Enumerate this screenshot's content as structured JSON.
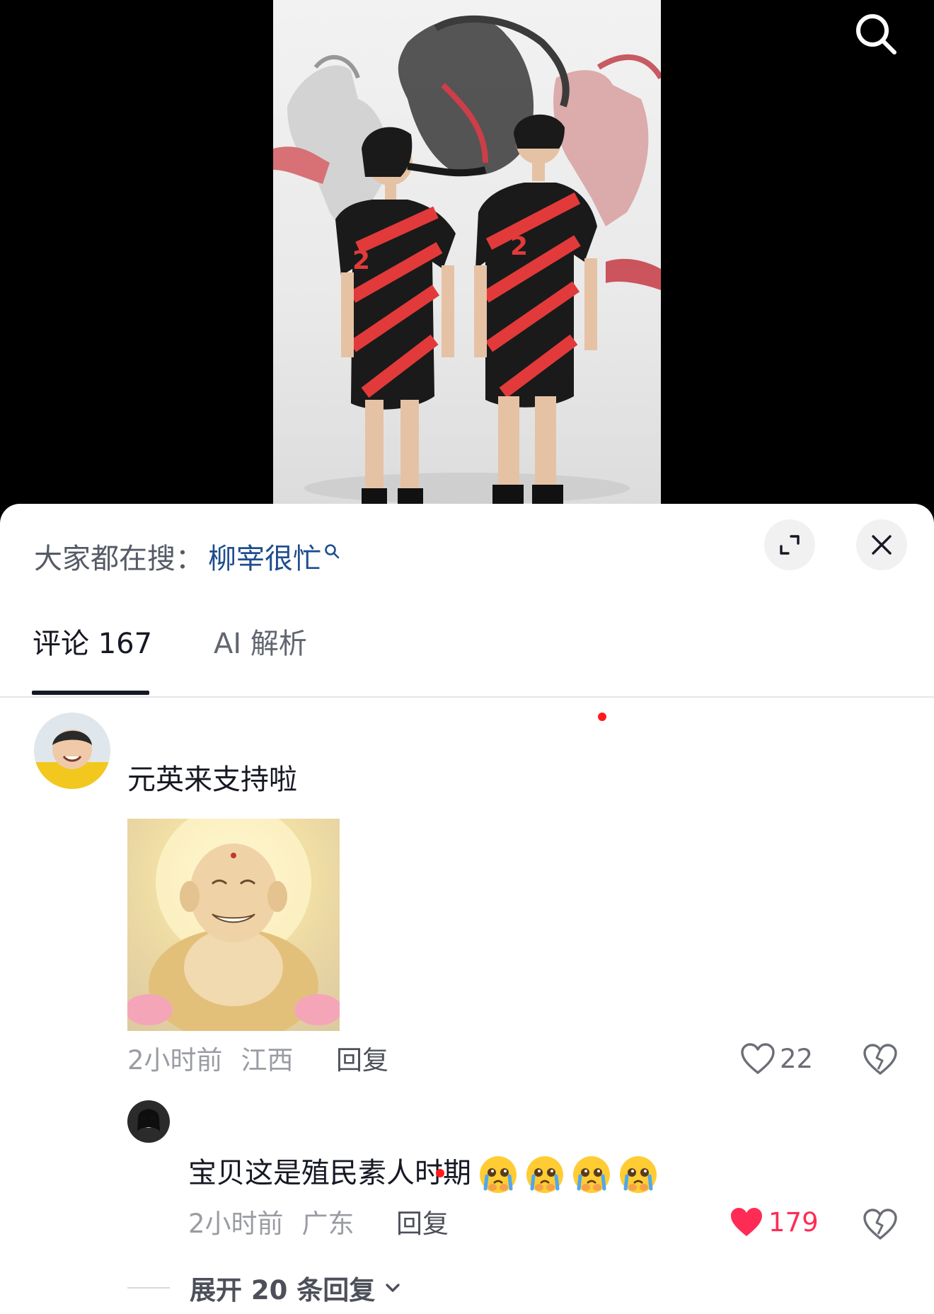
{
  "search_hint": {
    "prefix": "大家都在搜：",
    "term": "柳宰很忙"
  },
  "tabs": [
    {
      "label": "评论 167",
      "active": true
    },
    {
      "label": "AI 解析",
      "active": false
    }
  ],
  "comments": [
    {
      "text": "元英来支持啦",
      "time": "2小时前",
      "location": "江西",
      "reply_label": "回复",
      "likes": "22",
      "liked": false
    },
    {
      "text": "宝贝这是殖民素人时期",
      "emoji": [
        "crying-face-emoji",
        "crying-face-emoji",
        "crying-face-emoji",
        "crying-face-emoji"
      ],
      "time": "2小时前",
      "location": "广东",
      "reply_label": "回复",
      "likes": "179",
      "liked": true
    }
  ],
  "expand_replies": "展开 20 条回复",
  "colors": {
    "like_active": "#fe2c55",
    "link": "#1f4d8f",
    "text_primary": "#161823",
    "text_secondary": "#9a9ca3"
  },
  "icons": [
    "search-icon",
    "expand-icon",
    "close-icon",
    "heart-icon",
    "dislike-heart-icon",
    "chevron-down-icon"
  ]
}
